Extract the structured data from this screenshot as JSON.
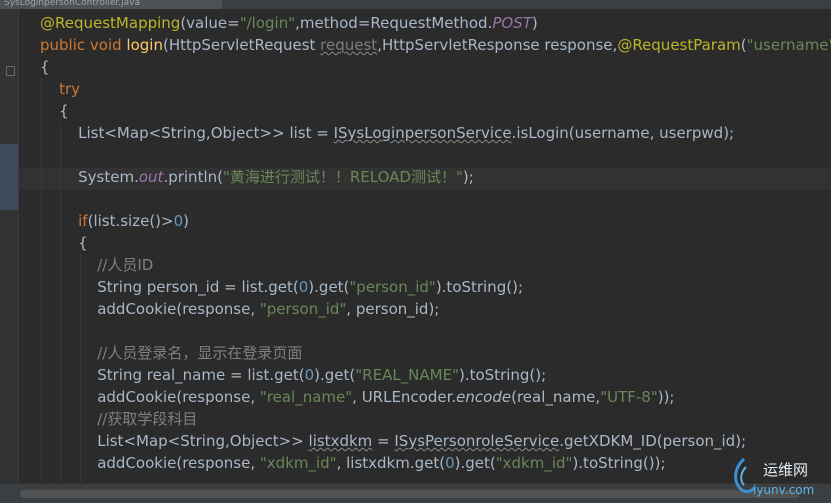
{
  "tab": {
    "title": "SysLoginpersonController.java"
  },
  "code_lines": [
    [
      [
        "ann",
        "@RequestMapping"
      ],
      [
        "",
        "(value="
      ],
      [
        "str",
        "\"/login\""
      ],
      [
        "",
        ",method=RequestMethod."
      ],
      [
        "field",
        "POST"
      ],
      [
        "",
        ")"
      ]
    ],
    [
      [
        "kw",
        "public void "
      ],
      [
        "fn",
        "login"
      ],
      [
        "",
        "(HttpServletRequest "
      ],
      [
        "unused",
        "request"
      ],
      [
        "",
        ",HttpServletResponse response,"
      ],
      [
        "ann",
        "@RequestParam"
      ],
      [
        "",
        "("
      ],
      [
        "str",
        "\"username\""
      ]
    ],
    [
      [
        "",
        "{"
      ]
    ],
    [
      [
        "kw",
        "    try"
      ]
    ],
    [
      [
        "",
        "    {"
      ]
    ],
    [
      [
        "",
        "        List<Map<String,Object>> list = "
      ],
      [
        "err",
        "ISysLoginpersonService"
      ],
      [
        "",
        ".isLogin(username, userpwd);"
      ]
    ],
    [
      [
        "",
        ""
      ]
    ],
    [
      [
        "",
        "        System."
      ],
      [
        "field",
        "out"
      ],
      [
        "",
        ".println("
      ],
      [
        "str",
        "\"黄海进行测试！！RELOAD测试！\""
      ],
      [
        "",
        ");"
      ]
    ],
    [
      [
        "",
        ""
      ]
    ],
    [
      [
        "kw",
        "        if"
      ],
      [
        "",
        "(list.size()>"
      ],
      [
        "num",
        "0"
      ],
      [
        "",
        ")"
      ]
    ],
    [
      [
        "",
        "        {"
      ]
    ],
    [
      [
        "cmt",
        "            //人员ID"
      ]
    ],
    [
      [
        "",
        "            String person_id = list.get("
      ],
      [
        "num",
        "0"
      ],
      [
        "",
        ").get("
      ],
      [
        "str",
        "\"person_id\""
      ],
      [
        "",
        ").toString();"
      ]
    ],
    [
      [
        "",
        "            addCookie(response, "
      ],
      [
        "str",
        "\"person_id\""
      ],
      [
        "",
        ", person_id);"
      ]
    ],
    [
      [
        "",
        ""
      ]
    ],
    [
      [
        "cmt",
        "            //人员登录名，显示在登录页面"
      ]
    ],
    [
      [
        "",
        "            String real_name = list.get("
      ],
      [
        "num",
        "0"
      ],
      [
        "",
        ").get("
      ],
      [
        "str",
        "\"REAL_NAME\""
      ],
      [
        "",
        ").toString();"
      ]
    ],
    [
      [
        "",
        "            addCookie(response, "
      ],
      [
        "str",
        "\"real_name\""
      ],
      [
        "",
        ", URLEncoder."
      ],
      [
        "ital",
        "encode"
      ],
      [
        "",
        "(real_name,"
      ],
      [
        "str",
        "\"UTF-8\""
      ],
      [
        "",
        "));"
      ]
    ],
    [
      [
        "cmt",
        "            //获取学段科目"
      ]
    ],
    [
      [
        "",
        "            List<Map<String,Object>> "
      ],
      [
        "err",
        "listxdkm"
      ],
      [
        "",
        " = "
      ],
      [
        "err",
        "ISysPersonroleService"
      ],
      [
        "",
        ".getXDKM_ID(person_id);"
      ]
    ],
    [
      [
        "",
        "            addCookie(response, "
      ],
      [
        "str",
        "\"xdkm_id\""
      ],
      [
        "",
        ", listxdkm.get("
      ],
      [
        "num",
        "0"
      ],
      [
        "",
        ").get("
      ],
      [
        "str",
        "\"xdkm_id\""
      ],
      [
        "",
        ").toString());"
      ]
    ]
  ],
  "watermark": {
    "cn": "运维网",
    "url": "iyunv.com"
  },
  "colors": {
    "background": "#2b2b2b",
    "keyword": "#cc7832",
    "annotation": "#bbb529",
    "string": "#6a8759",
    "number": "#6897bb",
    "comment": "#808080",
    "field": "#9876aa",
    "method_decl": "#ffc66d",
    "text": "#a9b7c6"
  }
}
